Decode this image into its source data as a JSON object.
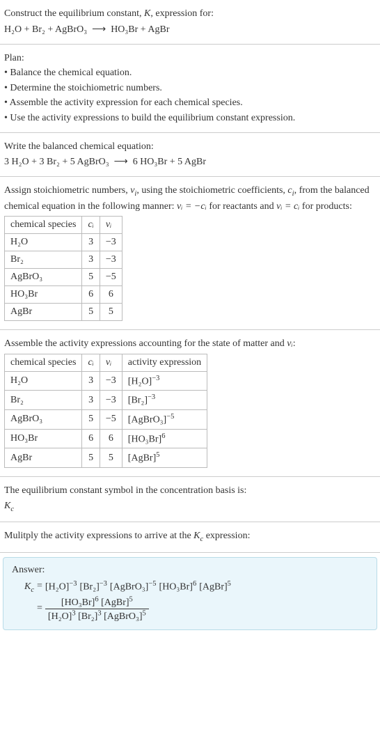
{
  "intro": {
    "line1_pre": "Construct the equilibrium constant, ",
    "line1_K": "K",
    "line1_post": ", expression for:",
    "eq_lhs": "H₂O + Br₂ + AgBrO₃",
    "eq_arrow": "⟶",
    "eq_rhs": "HO₃Br + AgBr"
  },
  "plan": {
    "title": "Plan:",
    "items": [
      "• Balance the chemical equation.",
      "• Determine the stoichiometric numbers.",
      "• Assemble the activity expression for each chemical species.",
      "• Use the activity expressions to build the equilibrium constant expression."
    ]
  },
  "balanced": {
    "title": "Write the balanced chemical equation:",
    "eq_lhs": "3 H₂O + 3 Br₂ + 5 AgBrO₃",
    "eq_arrow": "⟶",
    "eq_rhs": "6 HO₃Br + 5 AgBr"
  },
  "stoich": {
    "intro_a": "Assign stoichiometric numbers, ",
    "nu": "ν",
    "sub_i": "i",
    "intro_b": ", using the stoichiometric coefficients, ",
    "c": "c",
    "intro_c": ", from the balanced chemical equation in the following manner: ",
    "rel1": "νᵢ = −cᵢ",
    "intro_d": " for reactants and ",
    "rel2": "νᵢ = cᵢ",
    "intro_e": " for products:",
    "headers": [
      "chemical species",
      "cᵢ",
      "νᵢ"
    ],
    "rows": [
      {
        "sp": "H₂O",
        "c": "3",
        "nu": "−3"
      },
      {
        "sp": "Br₂",
        "c": "3",
        "nu": "−3"
      },
      {
        "sp": "AgBrO₃",
        "c": "5",
        "nu": "−5"
      },
      {
        "sp": "HO₃Br",
        "c": "6",
        "nu": "6"
      },
      {
        "sp": "AgBr",
        "c": "5",
        "nu": "5"
      }
    ]
  },
  "activity": {
    "intro_a": "Assemble the activity expressions accounting for the state of matter and ",
    "nu": "νᵢ",
    "intro_b": ":",
    "headers": [
      "chemical species",
      "cᵢ",
      "νᵢ",
      "activity expression"
    ],
    "rows": [
      {
        "sp": "H₂O",
        "c": "3",
        "nu": "−3",
        "base": "[H₂O]",
        "exp": "−3"
      },
      {
        "sp": "Br₂",
        "c": "3",
        "nu": "−3",
        "base": "[Br₂]",
        "exp": "−3"
      },
      {
        "sp": "AgBrO₃",
        "c": "5",
        "nu": "−5",
        "base": "[AgBrO₃]",
        "exp": "−5"
      },
      {
        "sp": "HO₃Br",
        "c": "6",
        "nu": "6",
        "base": "[HO₃Br]",
        "exp": "6"
      },
      {
        "sp": "AgBr",
        "c": "5",
        "nu": "5",
        "base": "[AgBr]",
        "exp": "5"
      }
    ]
  },
  "symbol": {
    "line": "The equilibrium constant symbol in the concentration basis is:",
    "Kc_base": "K",
    "Kc_sub": "c"
  },
  "multiply": {
    "line_a": "Mulitply the activity expressions to arrive at the ",
    "Kc_base": "K",
    "Kc_sub": "c",
    "line_b": " expression:"
  },
  "answer": {
    "title": "Answer:",
    "Kc_base": "K",
    "Kc_sub": "c",
    "eq": "=",
    "terms": [
      {
        "base": "[H₂O]",
        "exp": "−3"
      },
      {
        "base": "[Br₂]",
        "exp": "−3"
      },
      {
        "base": "[AgBrO₃]",
        "exp": "−5"
      },
      {
        "base": "[HO₃Br]",
        "exp": "6"
      },
      {
        "base": "[AgBr]",
        "exp": "5"
      }
    ],
    "num": [
      {
        "base": "[HO₃Br]",
        "exp": "6"
      },
      {
        "base": "[AgBr]",
        "exp": "5"
      }
    ],
    "den": [
      {
        "base": "[H₂O]",
        "exp": "3"
      },
      {
        "base": "[Br₂]",
        "exp": "3"
      },
      {
        "base": "[AgBrO₃]",
        "exp": "5"
      }
    ]
  }
}
